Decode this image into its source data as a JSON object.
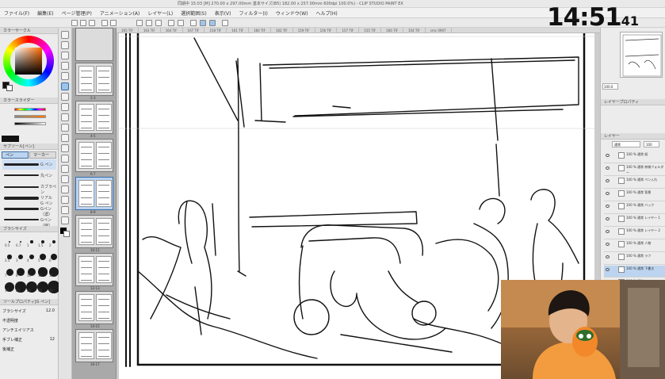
{
  "titlebar": {
    "text": "同期中 15:03 [M] 270.00 x 297.00mm 基本サイズ(B5) 182.00 x 257.00mm 600dpi 100.0%) - CLIP STUDIO PAINT EX"
  },
  "menu": [
    "ファイル(F)",
    "編集(E)",
    "ページ管理(P)",
    "アニメーション(A)",
    "レイヤー(L)",
    "選択範囲(S)",
    "表示(V)",
    "フィルター(I)",
    "ウィンドウ(W)",
    "ヘルプ(H)"
  ],
  "clock": {
    "time": "14:51",
    "seconds": "41"
  },
  "left_panel": {
    "color_wheel_header": "カラーサークル",
    "color_slider_header": "カラースライダー",
    "sub_tool_header": "サブツール[ペン]",
    "sub_tool_tabs": [
      "ペン",
      "マーカー"
    ],
    "brushes": [
      "G ペン",
      "丸ペン",
      "カブラペン",
      "リアル G ペン",
      "Gペン（濃）",
      "Gペン（線）"
    ],
    "brush_size_header": "ブラシサイズ",
    "brush_sizes": [
      "0.5",
      "0.7",
      "1",
      "1.5",
      "2",
      "2.5",
      "3",
      "4",
      "5",
      "6",
      "7",
      "8",
      "10",
      "12",
      "15",
      "17",
      "20",
      "25",
      "30",
      "40"
    ],
    "tool_property_header": "ツールプロパティ[G ペン]",
    "property_rows": [
      "ブラシサイズ",
      "不透明度",
      "アンチエイリアス",
      "手ブレ補正",
      "後補正"
    ],
    "property_values": [
      "12.0",
      "",
      "",
      "12",
      ""
    ]
  },
  "tabs": [
    "165 TIF",
    "163 TIF",
    "164 TIF",
    "167 TIF",
    "158 TIF",
    "161 TIF",
    "160 TIF",
    "162 TIF",
    "159 TIF",
    "156 TIF",
    "157 TIF",
    "155 TIF",
    "166 TIF",
    "154 TIF",
    "cmc 0907"
  ],
  "pages": [
    "2-3",
    "4-5",
    "6-7",
    "8-9",
    "10-11",
    "12-13",
    "14-15",
    "16-17"
  ],
  "right_panel": {
    "nav_zoom": "100.0",
    "layer_property_header": "レイヤープロパティ",
    "layer_header": "レイヤー",
    "blend_mode": "通常",
    "opacity": "100",
    "layers": [
      "100 % 通常 紙",
      "100 % 通常 枠線フォルダー",
      "100 % 通常 ペン入れ",
      "100 % 通常 背景",
      "100 % 通常 バック",
      "100 % 通常 レイヤー 1",
      "100 % 通常 レイヤー 2",
      "100 % 通常 人物",
      "100 % 通常 ラフ",
      "100 % 通常 下書き",
      "100 % 通常 トーン",
      "100 % 通常 ラフスケッチ",
      "用紙"
    ]
  },
  "colors": {
    "accent": "#3a6ea8",
    "highlight_layer": "#fbfb8e",
    "selected_layer": "#bcd4ef"
  }
}
